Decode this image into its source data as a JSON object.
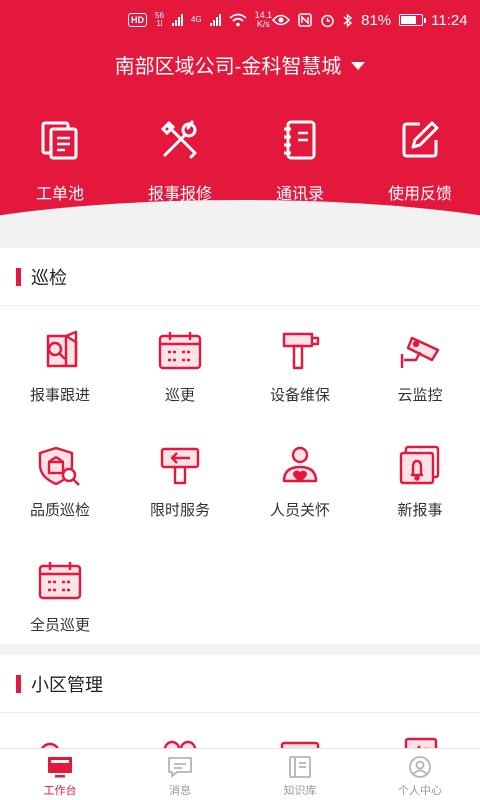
{
  "status_bar": {
    "hd": "HD",
    "net_top": "56",
    "net_bottom": "1l",
    "net2": "4G",
    "speed_value": "14.1",
    "speed_unit": "K/s",
    "battery_text": "81%",
    "battery_level": 0.81,
    "time": "11:24"
  },
  "header": {
    "company": "南部区域公司-金科智慧城",
    "quick_items": [
      {
        "label": "工单池",
        "icon": "document-stack-icon"
      },
      {
        "label": "报事报修",
        "icon": "tools-icon"
      },
      {
        "label": "通讯录",
        "icon": "notebook-icon"
      },
      {
        "label": "使用反馈",
        "icon": "edit-icon"
      }
    ]
  },
  "sections": {
    "inspection": {
      "title": "巡检",
      "items": [
        {
          "label": "报事跟进",
          "icon": "report-follow-icon"
        },
        {
          "label": "巡更",
          "icon": "calendar-icon"
        },
        {
          "label": "设备维保",
          "icon": "hammer-icon"
        },
        {
          "label": "云监控",
          "icon": "camera-icon"
        },
        {
          "label": "品质巡检",
          "icon": "quality-inspection-icon"
        },
        {
          "label": "限时服务",
          "icon": "signpost-icon"
        },
        {
          "label": "人员关怀",
          "icon": "person-care-icon"
        },
        {
          "label": "新报事",
          "icon": "bell-icon"
        },
        {
          "label": "全员巡更",
          "icon": "calendar-icon"
        }
      ]
    },
    "community": {
      "title": "小区管理",
      "items": [
        {
          "label": "",
          "icon": "key-icon"
        },
        {
          "label": "",
          "icon": "people-icon"
        },
        {
          "label": "",
          "icon": "certificate-icon"
        },
        {
          "label": "",
          "icon": "checklist-icon"
        }
      ]
    }
  },
  "tabbar": [
    {
      "label": "工作台",
      "icon": "workbench-icon",
      "active": true
    },
    {
      "label": "消息",
      "icon": "message-icon",
      "active": false
    },
    {
      "label": "知识库",
      "icon": "knowledge-icon",
      "active": false
    },
    {
      "label": "个人中心",
      "icon": "user-icon",
      "active": false
    }
  ],
  "colors": {
    "brand": "#e4173c",
    "background": "#f2f2f2",
    "inactive": "#9a9a9a"
  }
}
